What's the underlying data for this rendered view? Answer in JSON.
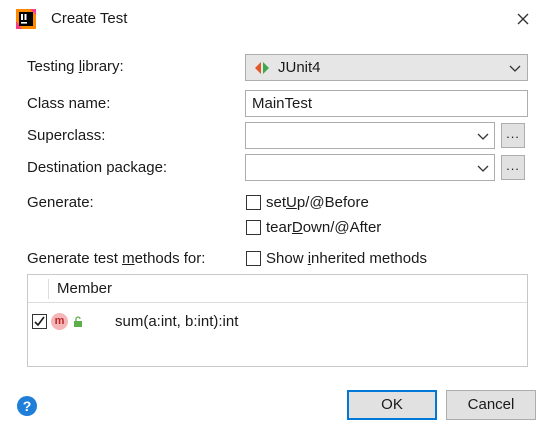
{
  "window": {
    "title": "Create Test",
    "colors": {
      "accent": "#0078d7",
      "help": "#1f7ed8",
      "method_badge": "#f4b6b6"
    }
  },
  "form": {
    "testing_library": {
      "label_pre": "Testing ",
      "label_mnemonic": "l",
      "label_post": "ibrary:",
      "value": "JUnit4",
      "icon": "junit-icon"
    },
    "class_name": {
      "label": "Class name:",
      "value": "MainTest"
    },
    "superclass": {
      "label": "Superclass:",
      "value": "",
      "browse_label": "..."
    },
    "destination_package": {
      "label": "Destination package:",
      "value": "",
      "browse_label": "..."
    },
    "generate": {
      "label": "Generate:",
      "setup": {
        "pre": "set",
        "mnemonic": "U",
        "post": "p/@Before",
        "checked": false
      },
      "teardown": {
        "pre": "tear",
        "mnemonic": "D",
        "post": "own/@After",
        "checked": false
      }
    },
    "methods_for": {
      "label_pre": "Generate test ",
      "label_mnemonic": "m",
      "label_post": "ethods for:",
      "show_inherited": {
        "pre": "Show ",
        "mnemonic": "i",
        "post": "nherited methods",
        "checked": false
      }
    }
  },
  "table": {
    "columns": [
      "Member"
    ],
    "rows": [
      {
        "checked": true,
        "badge": "m",
        "signature": "sum(a:int, b:int):int"
      }
    ]
  },
  "buttons": {
    "ok": "OK",
    "cancel": "Cancel",
    "help": "?"
  }
}
